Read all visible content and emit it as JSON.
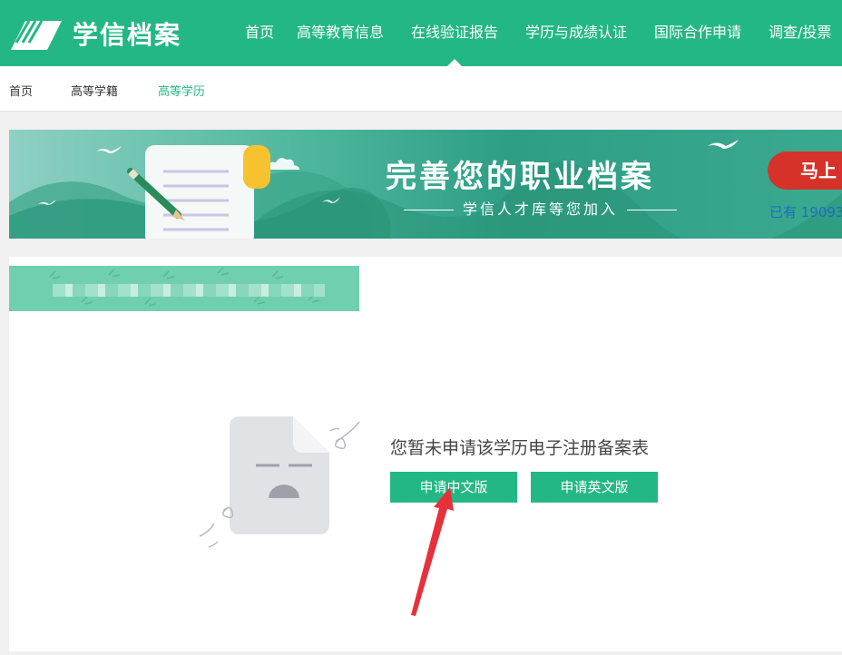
{
  "header": {
    "logo_text": "学信档案",
    "nav": [
      {
        "label": "首页"
      },
      {
        "label": "高等教育信息"
      },
      {
        "label": "在线验证报告"
      },
      {
        "label": "学历与成绩认证"
      },
      {
        "label": "国际合作申请"
      },
      {
        "label": "调查/投票"
      }
    ]
  },
  "breadcrumbs": [
    {
      "label": "首页"
    },
    {
      "label": "高等学籍"
    },
    {
      "label": "高等学历"
    }
  ],
  "banner": {
    "title": "完善您的职业档案",
    "subtitle": "学信人才库等您加入",
    "button_label": "马上",
    "count_text": "已有 19093"
  },
  "main": {
    "empty_message": "您暂未申请该学历电子注册备案表",
    "apply_cn_label": "申请中文版",
    "apply_en_label": "申请英文版"
  },
  "colors": {
    "brand": "#24b786",
    "banner_button": "#d6322a",
    "link_blue": "#1e6cc4"
  },
  "icons": [
    "logo-book-icon",
    "document-sad-icon",
    "bird-icon",
    "cloud-icon",
    "pencil-icon",
    "annotation-arrow"
  ]
}
